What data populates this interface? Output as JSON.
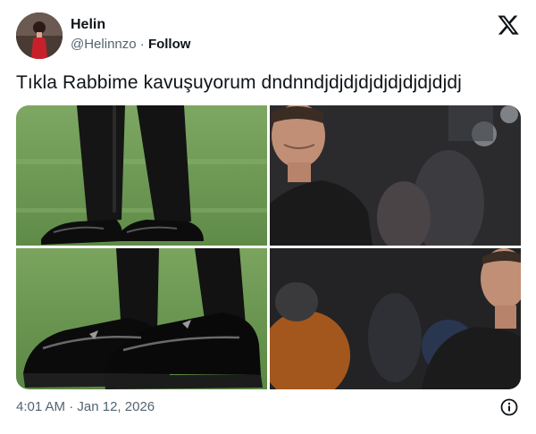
{
  "author": {
    "name": "Helin",
    "handle": "@Helinnzo",
    "separator": "·",
    "follow_label": "Follow"
  },
  "tweet": {
    "text": "Tıkla Rabbime kavuşuyorum dndnndjdjdjdjdjdjdjdjdjdj"
  },
  "media": {
    "photos": [
      {
        "icon": "legs-black-shoes-grass-photo"
      },
      {
        "icon": "man-black-shirt-stadium-photo"
      },
      {
        "icon": "black-platform-shoes-closeup-photo"
      },
      {
        "icon": "man-black-shirt-crowd-photo"
      }
    ]
  },
  "timestamp": {
    "time": "4:01 AM",
    "separator": "·",
    "date": "Jan 12, 2026"
  },
  "icons": {
    "brand": "x-logo-icon",
    "info": "info-icon"
  },
  "colors": {
    "text_primary": "#0f1419",
    "text_secondary": "#536471",
    "pitch_green": "#6e9a56",
    "shirt_black": "#1b1b1b"
  }
}
